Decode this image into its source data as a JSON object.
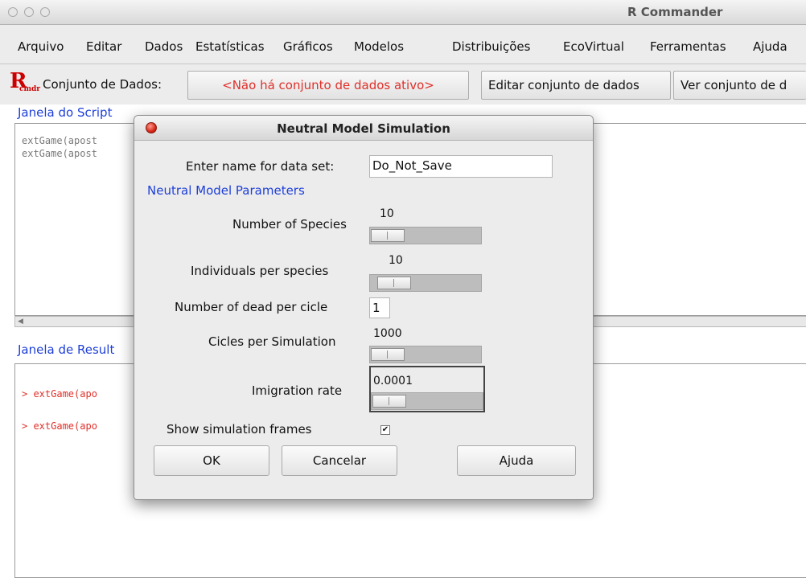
{
  "window": {
    "title": "R Commander"
  },
  "menu": [
    "Arquivo",
    "Editar",
    "Dados",
    "Estatísticas",
    "Gráficos",
    "Modelos",
    "Distribuições",
    "EcoVirtual",
    "Ferramentas",
    "Ajuda"
  ],
  "toolbar": {
    "logo": "R",
    "logo_sub": "cmdr",
    "dataset_label": "Conjunto de Dados:",
    "dataset_value": "<Não há conjunto de dados ativo>",
    "edit_button": "Editar conjunto de dados",
    "view_button": "Ver conjunto de d"
  },
  "script_pane": {
    "label": "Janela do Script",
    "lines": [
      "extGame(apost",
      "extGame(apost"
    ]
  },
  "results_pane": {
    "label": "Janela de Result",
    "lines": [
      "> extGame(apo",
      "> extGame(apo"
    ]
  },
  "dialog": {
    "title": "Neutral Model Simulation",
    "dataset_name_label": "Enter name for data set:",
    "dataset_name_value": "Do_Not_Save",
    "section_label": "Neutral Model Parameters",
    "num_species": {
      "label": "Number of Species",
      "value": "10"
    },
    "individuals": {
      "label": "Individuals per species",
      "value": "10"
    },
    "dead_per_cicle": {
      "label": "Number of dead per cicle",
      "value": "1"
    },
    "cicles": {
      "label": "Cicles per Simulation",
      "value": "1000"
    },
    "imigration": {
      "label": "Imigration rate",
      "value": "0.0001"
    },
    "show_frames": {
      "label": "Show simulation frames",
      "checked": true,
      "mark": "✔"
    },
    "buttons": {
      "ok": "OK",
      "cancel": "Cancelar",
      "help": "Ajuda"
    }
  },
  "colors": {
    "accent_blue": "#1d3fd8",
    "dataset_red": "#e0302a",
    "close_red": "#d31e0e"
  }
}
